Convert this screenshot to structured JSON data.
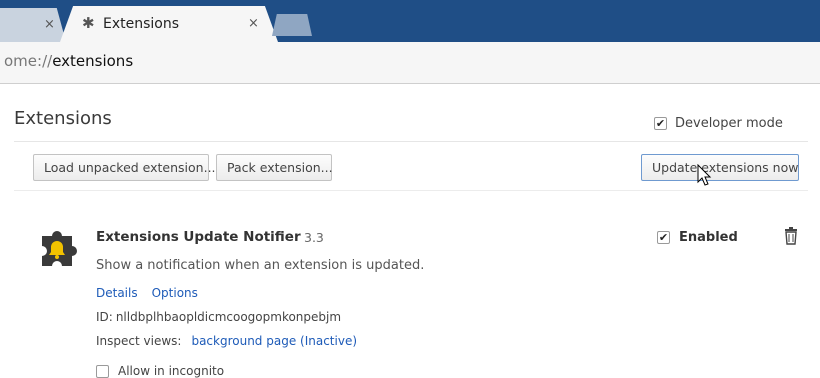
{
  "tabs": {
    "previous_close": "×",
    "active_title": "Extensions",
    "active_close": "×"
  },
  "omnibox": {
    "url_prefix": "ome://",
    "url_host": "extensions"
  },
  "page": {
    "title": "Extensions",
    "developer_mode_label": "Developer mode",
    "developer_mode_checked": true
  },
  "toolbar": {
    "load_unpacked_label": "Load unpacked extension...",
    "pack_label": "Pack extension...",
    "update_label": "Update extensions now"
  },
  "extension": {
    "name": "Extensions Update Notifier",
    "version": "3.3",
    "description": "Show a notification when an extension is updated.",
    "links": [
      "Details",
      "Options"
    ],
    "id_label": "ID:",
    "id_value": "nlldbplhbaopldicmcoogopmkonpebjm",
    "inspect_label": "Inspect views:",
    "inspect_link": "background page (Inactive)",
    "incognito_label": "Allow in incognito",
    "incognito_checked": false,
    "enabled_label": "Enabled",
    "enabled_checked": true,
    "icon": "puzzle-bell-icon"
  },
  "colors": {
    "tabstrip": "#1f4e86",
    "link": "#1e5bb8",
    "icon_yellow": "#f2c200"
  }
}
